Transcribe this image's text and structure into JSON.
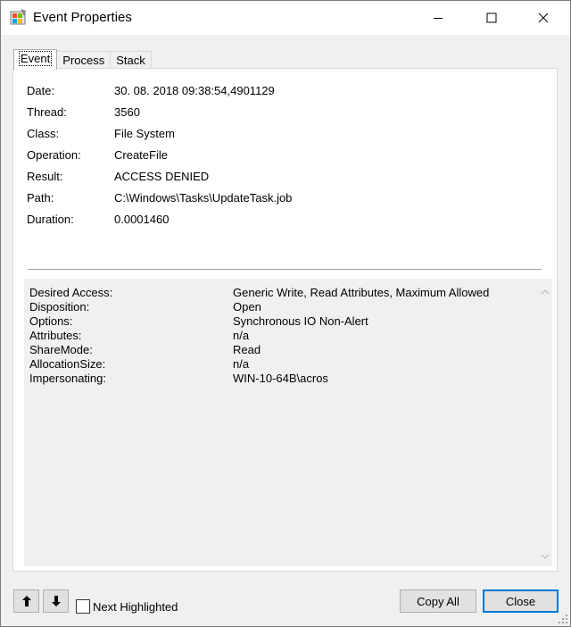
{
  "window": {
    "title": "Event Properties",
    "icon": "procmon-app-icon"
  },
  "tabs": [
    {
      "label": "Event",
      "active": true
    },
    {
      "label": "Process",
      "active": false
    },
    {
      "label": "Stack",
      "active": false
    }
  ],
  "fields": [
    {
      "label": "Date:",
      "value": "30. 08. 2018 09:38:54,4901129"
    },
    {
      "label": "Thread:",
      "value": "3560"
    },
    {
      "label": "Class:",
      "value": "File System"
    },
    {
      "label": "Operation:",
      "value": "CreateFile"
    },
    {
      "label": "Result:",
      "value": "ACCESS DENIED"
    },
    {
      "label": "Path:",
      "value": "C:\\Windows\\Tasks\\UpdateTask.job"
    },
    {
      "label": "Duration:",
      "value": "0.0001460"
    }
  ],
  "details": [
    {
      "label": "Desired Access:",
      "value": "Generic Write, Read Attributes, Maximum Allowed"
    },
    {
      "label": "Disposition:",
      "value": "Open"
    },
    {
      "label": "Options:",
      "value": "Synchronous IO Non-Alert"
    },
    {
      "label": "Attributes:",
      "value": "n/a"
    },
    {
      "label": "ShareMode:",
      "value": "Read"
    },
    {
      "label": "AllocationSize:",
      "value": "n/a"
    },
    {
      "label": "Impersonating:",
      "value": "WIN-10-64B\\acros"
    }
  ],
  "footer": {
    "next_highlighted_label": "Next Highlighted",
    "next_highlighted_checked": false,
    "copy_all_label": "Copy All",
    "close_label": "Close"
  },
  "colors": {
    "accent": "#0078d7",
    "window_bg": "#f0f0f0",
    "panel_bg": "#ffffff"
  }
}
